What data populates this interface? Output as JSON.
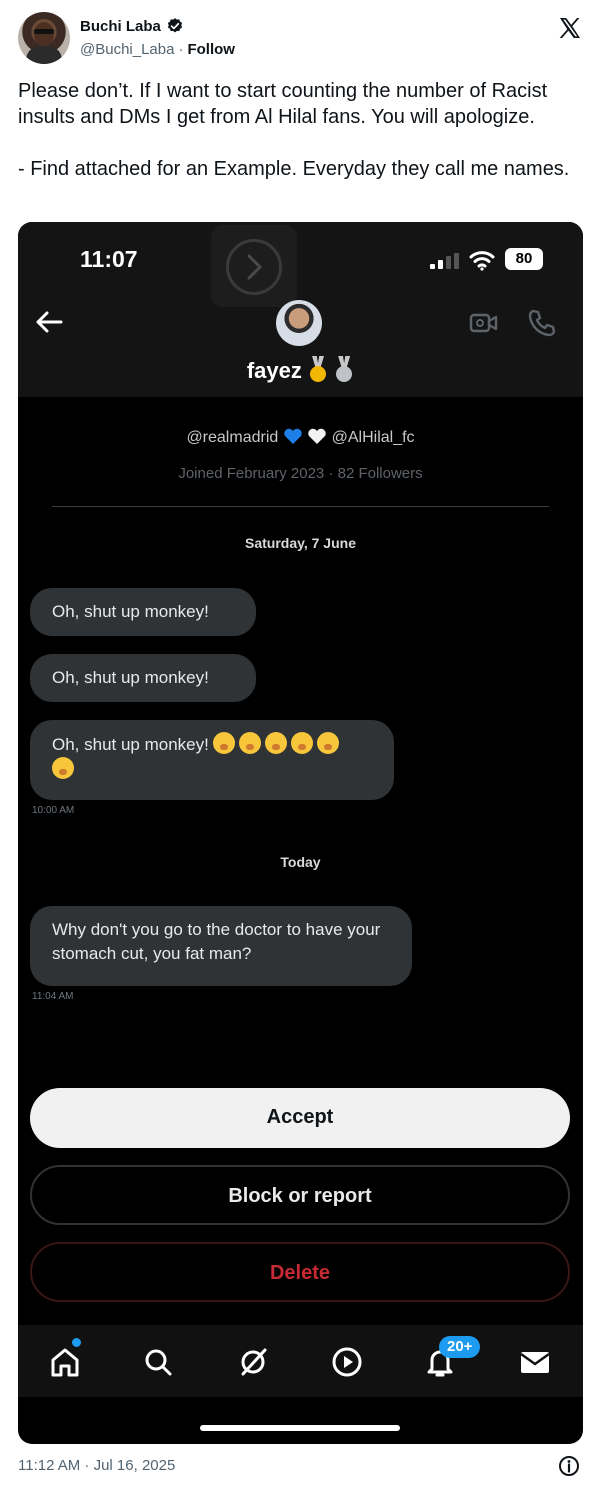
{
  "tweet": {
    "author_name": "Buchi Laba",
    "author_handle": "@Buchi_Laba",
    "separator": "·",
    "follow_label": "Follow",
    "text_line1": "Please don’t. If I want to start counting the number of Racist insults and DMs I get from Al Hilal fans. You will apologize.",
    "text_line2": "- Find attached for an Example. Everyday they call me names.",
    "timestamp": "11:12 AM · Jul 16, 2025"
  },
  "screenshot": {
    "status_bar": {
      "time": "11:07",
      "battery": "80"
    },
    "chat_header": {
      "name": "fayez"
    },
    "profile": {
      "bio_part1": "@realmadrid",
      "bio_part2": "@AlHilal_fc",
      "joined": "Joined February 2023 · 82 Followers"
    },
    "messages": {
      "date1": "Saturday, 7 June",
      "msg1": "Oh, shut up monkey!",
      "msg2": "Oh, shut up monkey!",
      "msg3": "Oh, shut up monkey!",
      "time1": "10:00 AM",
      "date2": "Today",
      "msg4": "Why don't you go to the doctor to have your stomach cut, you fat man?",
      "time2": "11:04 AM"
    },
    "actions": {
      "accept": "Accept",
      "block_or_report": "Block or report",
      "delete": "Delete"
    },
    "tab_bar": {
      "notification_count": "20+"
    }
  },
  "colors": {
    "accent_blue": "#1d9bf0",
    "delete_red": "#c72a33",
    "bubble_gray": "#2f3336"
  }
}
